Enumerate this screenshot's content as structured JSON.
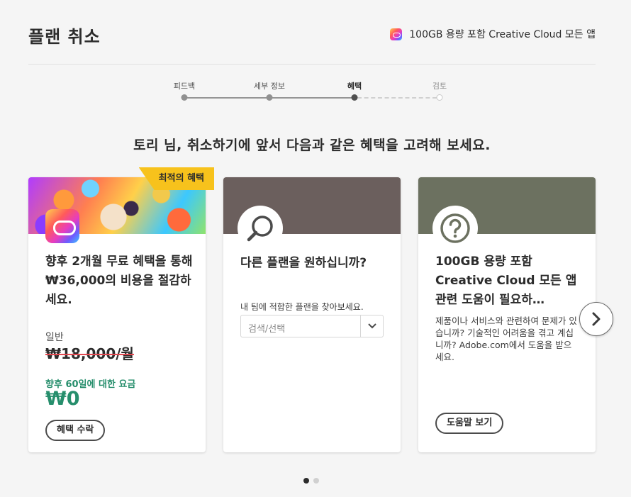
{
  "header": {
    "title": "플랜 취소",
    "plan_name": "100GB 용량 포함 Creative Cloud 모든 앱"
  },
  "steps": [
    {
      "label": "피드백",
      "state": "done"
    },
    {
      "label": "세부 정보",
      "state": "done"
    },
    {
      "label": "혜택",
      "state": "active"
    },
    {
      "label": "검토",
      "state": "todo"
    }
  ],
  "headline": "토리 님, 취소하기에 앞서 다음과 같은 혜택을 고려해 보세요.",
  "cards": {
    "offer": {
      "badge": "최적의 혜택",
      "title": "향후 2개월 무료 혜택을 통해 ₩36,000의 비용을 절감하세요.",
      "regular_label": "일반",
      "regular_price": "₩18,000/월",
      "promo_label": "향후 60일에 대한 요금",
      "promo_price": "₩0",
      "button": "혜택 수락",
      "icon": "creative-cloud-icon"
    },
    "plans": {
      "title": "다른 플랜을 원하십니까?",
      "hint": "내 팀에 적합한 플랜을 찾아보세요.",
      "select_placeholder": "검색/선택",
      "icon": "search-icon"
    },
    "help": {
      "title": "100GB 용량 포함 Creative Cloud 모든 앱 관련 도움이 필요하…",
      "description": "제품이나 서비스와 관련하여 문제가 있습니까? 기술적인 어려움을 겪고 계십니까? Adobe.com에서 도움을 받으세요.",
      "button": "도움말 보기",
      "icon": "question-icon"
    }
  },
  "carousel": {
    "pages": 2,
    "current": 1
  },
  "colors": {
    "accent_green": "#268e6c",
    "badge_yellow": "#f7c21c",
    "strike_red": "#e34850",
    "card2_header": "#6b5f5d",
    "card3_header": "#6c7160"
  }
}
